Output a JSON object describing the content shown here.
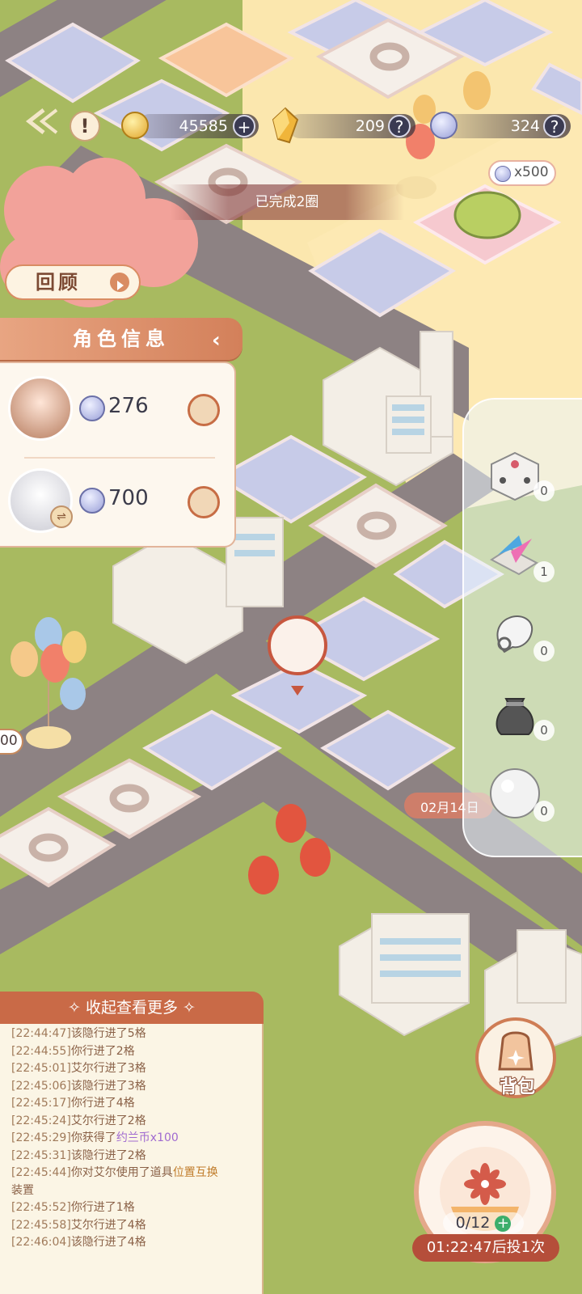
{
  "top_bar": {
    "gold": "45585",
    "crystal": "209",
    "token": "324"
  },
  "bubble_reward": "x500",
  "banner_text": "已完成2圈",
  "review_button": "回顾",
  "left_edge_label": "00",
  "date_tag": "02月14日",
  "role_panel": {
    "title": "角色信息",
    "players": [
      {
        "value": "276"
      },
      {
        "value": "700"
      }
    ]
  },
  "items": [
    {
      "name": "dice",
      "count": "0"
    },
    {
      "name": "swap-arrows",
      "count": "1"
    },
    {
      "name": "glove",
      "count": "0"
    },
    {
      "name": "bag",
      "count": "0"
    },
    {
      "name": "snowball",
      "count": "0"
    }
  ],
  "log": {
    "header": "收起查看更多",
    "lines": [
      {
        "ts": "[22:44:47]",
        "text": "该隐行进了5格"
      },
      {
        "ts": "[22:44:55]",
        "text": "你行进了2格"
      },
      {
        "ts": "[22:45:01]",
        "text": "艾尔行进了3格"
      },
      {
        "ts": "[22:45:06]",
        "text": "该隐行进了3格"
      },
      {
        "ts": "[22:45:17]",
        "text": "你行进了4格"
      },
      {
        "ts": "[22:45:24]",
        "text": "艾尔行进了2格"
      },
      {
        "ts": "[22:45:29]",
        "text": "你获得了",
        "extra": "约兰币x100"
      },
      {
        "ts": "[22:45:31]",
        "text": "该隐行进了2格"
      },
      {
        "ts": "[22:45:44]",
        "text": "你对艾尔使用了道具",
        "extra": "位置互换"
      },
      {
        "ts": "",
        "text": "装置"
      },
      {
        "ts": "[22:45:52]",
        "text": "你行进了1格"
      },
      {
        "ts": "[22:45:58]",
        "text": "艾尔行进了4格"
      },
      {
        "ts": "[22:46:04]",
        "text": "该隐行进了4格"
      }
    ]
  },
  "bag_label": "背包",
  "roll_count": "0/12",
  "timer": "01:22:47后投1次"
}
